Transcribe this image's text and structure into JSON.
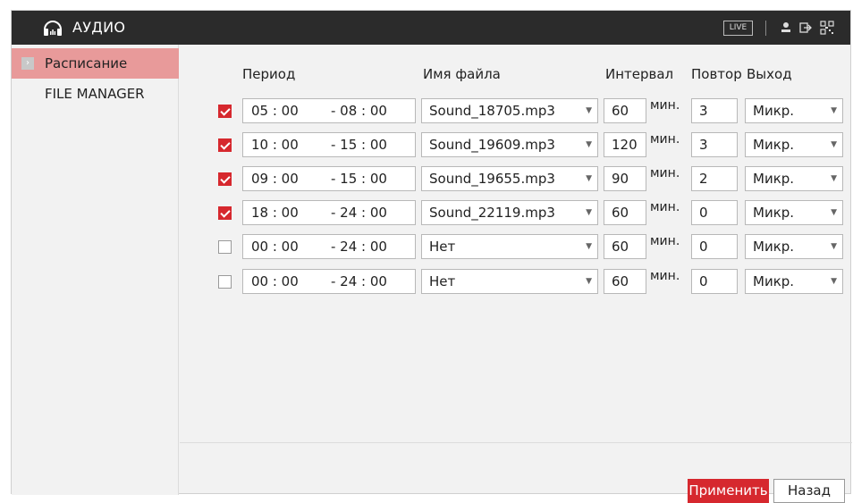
{
  "window": {
    "title": "АУДИО",
    "live_label": "LIVE"
  },
  "sidebar": {
    "items": [
      {
        "label": "Расписание",
        "active": true
      },
      {
        "label": "FILE MANAGER",
        "active": false
      }
    ]
  },
  "table": {
    "headers": {
      "period": "Период",
      "file": "Имя файла",
      "interval": "Интервал",
      "repeat": "Повтор",
      "output": "Выход"
    },
    "unit": "мин.",
    "rows": [
      {
        "enabled": true,
        "start": "05 : 00",
        "end": "- 08 : 00",
        "file": "Sound_18705.mp3",
        "interval": "60",
        "repeat": "3",
        "output": "Микр."
      },
      {
        "enabled": true,
        "start": "10 : 00",
        "end": "- 15 : 00",
        "file": "Sound_19609.mp3",
        "interval": "120",
        "repeat": "3",
        "output": "Микр."
      },
      {
        "enabled": true,
        "start": "09 : 00",
        "end": "- 15 : 00",
        "file": "Sound_19655.mp3",
        "interval": "90",
        "repeat": "2",
        "output": "Микр."
      },
      {
        "enabled": true,
        "start": "18 : 00",
        "end": "- 24 : 00",
        "file": "Sound_22119.mp3",
        "interval": "60",
        "repeat": "0",
        "output": "Микр."
      },
      {
        "enabled": false,
        "start": "00 : 00",
        "end": "- 24 : 00",
        "file": "Нет",
        "interval": "60",
        "repeat": "0",
        "output": "Микр."
      },
      {
        "enabled": false,
        "start": "00 : 00",
        "end": "- 24 : 00",
        "file": "Нет",
        "interval": "60",
        "repeat": "0",
        "output": "Микр."
      }
    ]
  },
  "buttons": {
    "apply": "Применить",
    "back": "Назад"
  },
  "colors": {
    "accent": "#d6282e",
    "sidebar_active": "#e89a9a",
    "titlebar": "#2b2b2b"
  },
  "icons": [
    "headphones-icon",
    "user-icon",
    "logout-icon",
    "qr-icon",
    "chevron-right-icon",
    "dropdown-arrow-icon"
  ]
}
